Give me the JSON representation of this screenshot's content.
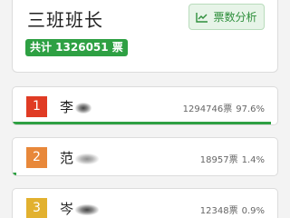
{
  "header": {
    "title": "三班班长",
    "analysis_button": "票数分析",
    "total_label": "共计 1326051 票"
  },
  "candidates": [
    {
      "rank": "1",
      "name": "李",
      "votes": "1294746票",
      "percent": "97.6%",
      "share": 0.976,
      "rank_color": "#e03b24"
    },
    {
      "rank": "2",
      "name": "范",
      "votes": "18957票",
      "percent": "1.4%",
      "share": 0.014,
      "rank_color": "#e8883a"
    },
    {
      "rank": "3",
      "name": "岑",
      "votes": "12348票",
      "percent": "0.9%",
      "share": 0.009,
      "rank_color": "#e2b12f"
    }
  ],
  "colors": {
    "accent": "#2ea043",
    "bar": "#2ea043"
  },
  "icons": {
    "analysis": "chart-line-icon"
  }
}
